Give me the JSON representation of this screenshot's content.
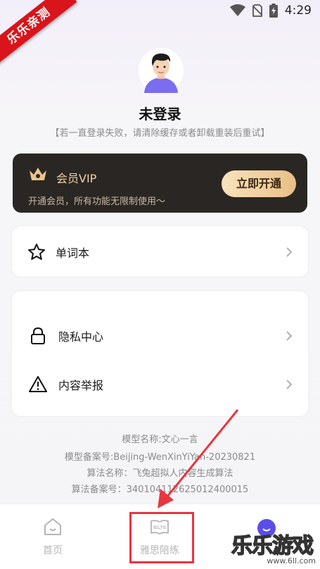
{
  "status_bar": {
    "time": "4:29"
  },
  "ribbon": {
    "text": "乐乐亲测"
  },
  "profile": {
    "username": "未登录",
    "hint": "【若一直登录失败，请清除缓存或者卸载重装后重试】"
  },
  "vip": {
    "title": "会员VIP",
    "subtitle": "开通会员，所有功能无限制使用～",
    "button": "立即开通"
  },
  "menu": {
    "vocab": "单词本",
    "privacy": "隐私中心",
    "report": "内容举报"
  },
  "model_info": {
    "line1": "模型名称:文心一言",
    "line2": "模型备案号:Beijing-WenXinYiYan-20230821",
    "line3": "算法名称：飞兔超拟人内容生成算法",
    "line4": "算法备案号：340104112625012400015"
  },
  "bottom_nav": {
    "home": "首页",
    "ielts": "雅思陪练",
    "ielts_badge": "IELTS"
  },
  "watermark": {
    "text": "乐乐游戏",
    "url": "www.6ll.com"
  },
  "colors": {
    "vip_bg": "#2a2623",
    "vip_gold": "#f0d3a6",
    "highlight": "#e8363f",
    "ribbon": "#d9141b"
  }
}
